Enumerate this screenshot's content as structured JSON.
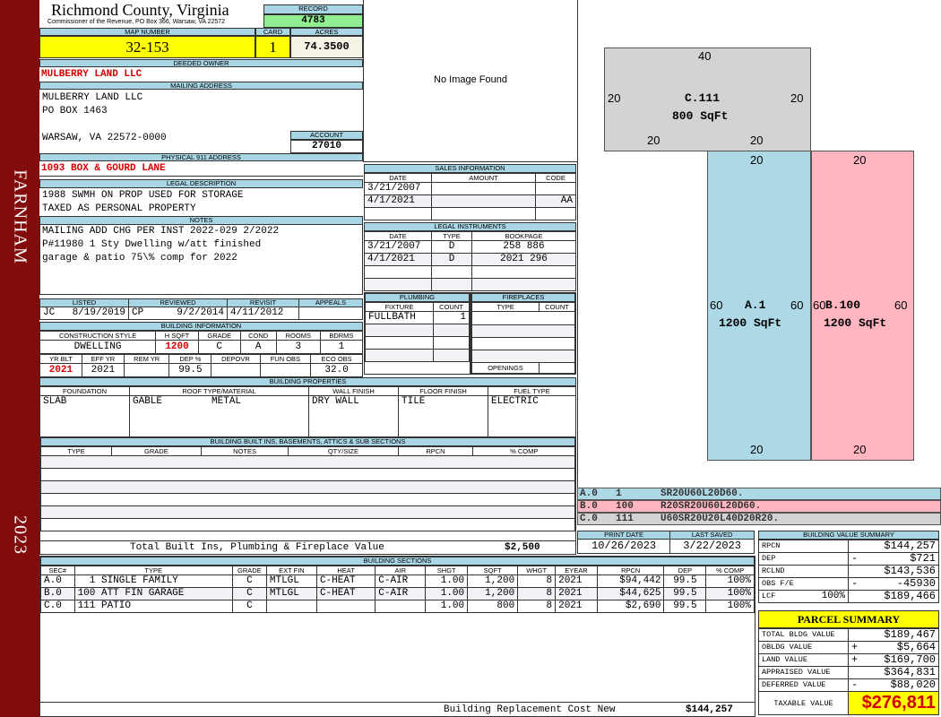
{
  "side": {
    "town": "FARNHAM",
    "year": "2023"
  },
  "header": {
    "title": "Richmond County, Virginia",
    "subtitle": "Commissioner of the Revenue, PO Box 366, Warsaw, VA 22572",
    "record_label": "RECORD",
    "record": "4783"
  },
  "parcel": {
    "map_label": "MAP NUMBER",
    "map": "32-153",
    "card_label": "CARD",
    "card": "1",
    "acres_label": "ACRES",
    "acres": "74.3500"
  },
  "owner": {
    "label": "DEEDED OWNER",
    "name": "MULBERRY LAND LLC"
  },
  "mailing": {
    "label": "MAILING ADDRESS",
    "line1": "MULBERRY LAND LLC",
    "line2": "PO BOX 1463",
    "line3": "WARSAW, VA 22572-0000",
    "account_label": "ACCOUNT",
    "account": "27010"
  },
  "address": {
    "label": "PHYSICAL 911 ADDRESS",
    "value": "1093 BOX & GOURD LANE"
  },
  "image": {
    "text": "No Image Found"
  },
  "legal": {
    "label": "LEGAL DESCRIPTION",
    "line1": "1988 SWMH ON PROP USED FOR STORAGE",
    "line2": "TAXED AS PERSONAL PROPERTY"
  },
  "notes": {
    "label": "NOTES",
    "line1": "MAILING ADD CHG PER INST 2022-029 2/2022",
    "line2": "P#11980 1 Sty Dwelling w/att finished",
    "line3": "garage & patio 75\\% comp for 2022"
  },
  "sales": {
    "label": "SALES INFORMATION",
    "cols": [
      "DATE",
      "AMOUNT",
      "CODE"
    ],
    "rows": [
      [
        "3/21/2007",
        "",
        ""
      ],
      [
        "4/1/2021",
        "",
        "AA"
      ],
      [
        "",
        "",
        ""
      ]
    ]
  },
  "instruments": {
    "label": "LEGAL INSTRUMENTS",
    "cols": [
      "DATE",
      "TYPE",
      "BOOKPAGE"
    ],
    "rows": [
      [
        "3/21/2007",
        "D",
        "258 886"
      ],
      [
        "4/1/2021",
        "D",
        "2021 296"
      ],
      [
        "",
        "",
        ""
      ],
      [
        "",
        "",
        ""
      ]
    ]
  },
  "review": {
    "listed_label": "LISTED",
    "listed_by": "JC",
    "listed": "8/19/2019",
    "reviewed_label": "REVIEWED",
    "reviewed_by": "CP",
    "reviewed": "9/2/2014",
    "revisit_label": "REVISIT",
    "revisit": "4/11/2012",
    "appeals_label": "APPEALS",
    "appeals": ""
  },
  "building_info": {
    "label": "BUILDING INFORMATION",
    "cols1": [
      "CONSTRUCTION STYLE",
      "H SQFT",
      "GRADE",
      "COND",
      "ROOMS",
      "BDRMS"
    ],
    "vals1": [
      "DWELLING",
      "1200",
      "C",
      "A",
      "3",
      "1"
    ],
    "cols2": [
      "YR BLT",
      "EFF YR",
      "REM YR",
      "DEP %",
      "DEPOVR",
      "FUN OBS",
      "ECO OBS"
    ],
    "vals2": [
      "2021",
      "2021",
      "",
      "99.5",
      "",
      "",
      "32.0"
    ]
  },
  "plumbing": {
    "label": "PLUMBING",
    "cols": [
      "FIXTURE",
      "COUNT"
    ],
    "rows": [
      [
        "FULLBATH",
        "1"
      ],
      [
        "",
        ""
      ],
      [
        "",
        ""
      ],
      [
        "",
        ""
      ]
    ]
  },
  "fireplaces": {
    "label": "FIREPLACES",
    "cols": [
      "TYPE",
      "COUNT"
    ],
    "openings": "OPENINGS"
  },
  "properties": {
    "label": "BUILDING PROPERTIES",
    "cols": [
      "FOUNDATION",
      "ROOF TYPE/MATERIAL",
      "WALL FINISH",
      "FLOOR FINISH",
      "FUEL TYPE"
    ],
    "foundation": "SLAB",
    "roof_type": "GABLE",
    "roof_material": "METAL",
    "wall": "DRY WALL",
    "floor": "TILE",
    "fuel": "ELECTRIC"
  },
  "builtins": {
    "label": "BUILDING BUILT INS, BASEMENTS, ATTICS & SUB SECTIONS",
    "cols": [
      "TYPE",
      "GRADE",
      "NOTES",
      "QTY/SIZE",
      "RPCN",
      "% COMP"
    ],
    "total_label": "Total Built Ins, Plumbing & Fireplace Value",
    "total": "$2,500"
  },
  "dates": {
    "print_label": "PRINT DATE",
    "print": "10/26/2023",
    "saved_label": "LAST SAVED",
    "saved": "3/22/2023"
  },
  "sections": {
    "label": "BUILDING SECTIONS",
    "cols": [
      "SEC#",
      "TYPE",
      "GRADE",
      "EXT FIN",
      "HEAT",
      "AIR",
      "SHGT",
      "SQFT",
      "WHGT",
      "EYEAR",
      "RPCN",
      "DEP",
      "% COMP"
    ],
    "rows": [
      [
        "A.0",
        "  1 SINGLE FAMILY",
        "C",
        "MTLGL",
        "C-HEAT",
        "C-AIR",
        "1.00",
        "1,200",
        "8",
        "2021",
        "$94,442",
        "99.5",
        "100%"
      ],
      [
        "B.0",
        "100 ATT FIN GARAGE",
        "C",
        "MTLGL",
        "C-HEAT",
        "C-AIR",
        "1.00",
        "1,200",
        "8",
        "2021",
        "$44,625",
        "99.5",
        "100%"
      ],
      [
        "C.0",
        "111 PATIO",
        "C",
        "",
        "",
        "",
        "1.00",
        "800",
        "8",
        "2021",
        "$2,690",
        "99.5",
        "100%"
      ]
    ],
    "cost_label": "Building Replacement Cost New",
    "cost": "$144,257"
  },
  "sketch": {
    "areas": [
      {
        "name": "C.111",
        "area": "800 SqFt",
        "top": "40",
        "left": "20",
        "right": "20",
        "bottom_l": "20",
        "bottom_r": "20",
        "color": "#d3d3d3"
      },
      {
        "name": "A.1",
        "area": "1200 SqFt",
        "top": "20",
        "left": "60",
        "right": "60",
        "bottom": "20",
        "color": "#add8e6"
      },
      {
        "name": "B.100",
        "area": "1200 SqFt",
        "top": "20",
        "left": "60",
        "right": "60",
        "bottom": "20",
        "color": "#ffb6c1"
      }
    ],
    "legend": [
      [
        "A.0",
        "1",
        "SR20U60L20D60."
      ],
      [
        "B.0",
        "100",
        "R20SR20U60L20D60."
      ],
      [
        "C.0",
        "111",
        "U60SR20U20L40D20R20."
      ]
    ]
  },
  "value_summary": {
    "label": "BUILDING VALUE SUMMARY",
    "rpcn_label": "RPCN",
    "rpcn": "$144,257",
    "dep_label": "DEP",
    "dep_sign": "-",
    "dep": "$721",
    "rclnd_label": "RCLND",
    "rclnd": "$143,536",
    "obs_label": "OBS F/E",
    "obs_sign": "-",
    "obs": "-45930",
    "lcf_label": "LCF",
    "lcf_pct": "100%",
    "lcf": "$189,466"
  },
  "parcel_summary": {
    "label": "PARCEL SUMMARY",
    "bldg_label": "TOTAL BLDG VALUE",
    "bldg": "$189,467",
    "obldg_label": "OBLDG VALUE",
    "obldg_sign": "+",
    "obldg": "$5,664",
    "land_label": "LAND VALUE",
    "land_sign": "+",
    "land": "$169,700",
    "appraised_label": "APPRAISED VALUE",
    "appraised": "$364,831",
    "deferred_label": "DEFERRED VALUE",
    "deferred_sign": "-",
    "deferred": "$88,020",
    "taxable_label": "TAXABLE VALUE",
    "taxable": "$276,811"
  },
  "colors": {
    "sidebar": "#820c0c",
    "header": "#a9d6e5",
    "map": "#ffff00",
    "record": "#90ee90",
    "red": "#d40000"
  }
}
